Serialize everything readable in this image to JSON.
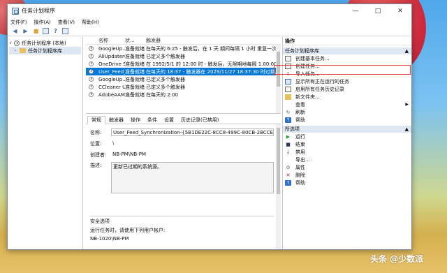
{
  "window": {
    "title": "任务计划程序"
  },
  "menu": [
    "文件(F)",
    "操作(A)",
    "查看(V)",
    "帮助(H)"
  ],
  "tree": {
    "root": "任务计划程序 (本地)",
    "child": "任务计划程序库"
  },
  "columns": [
    "名称",
    "状...",
    "触发器"
  ],
  "tasks": [
    {
      "name": "GoogleUp...",
      "status": "准备就绪",
      "trigger": "在每天的 6:25 - 触发后，在 1 天 期间每隔 1 小时 重复一次。"
    },
    {
      "name": "AliUpdater(...",
      "status": "准备就绪",
      "trigger": "已定义多个触发器"
    },
    {
      "name": "OneDrive S...",
      "status": "准备就绪",
      "trigger": "在 1992/5/1 的 12:00 时 - 触发后，无限期地每隔 1.00:00:00"
    },
    {
      "name": "User_Feed_...",
      "status": "准备就绪",
      "trigger": "在每天的 18:37 - 触发器在 2029/11/27 18:37:30 时过期。"
    },
    {
      "name": "GoogleUp...",
      "status": "准备就绪",
      "trigger": "已定义多个触发器"
    },
    {
      "name": "CCleaner U...",
      "status": "准备就绪",
      "trigger": "已定义多个触发器"
    },
    {
      "name": "AdobeAAM...",
      "status": "准备就绪",
      "trigger": "在每天的 2:00"
    }
  ],
  "tabs": [
    "常规",
    "触发器",
    "操作",
    "条件",
    "设置",
    "历史记录(已禁用)"
  ],
  "detail": {
    "name_label": "名称:",
    "name_value": "User_Feed_Synchronization-{5B1DE22C-8CC8-499C-80CB-2BCCE0CC8E20}",
    "location_label": "位置:",
    "location_value": "\\",
    "author_label": "创建者:",
    "author_value": "NB-PM\\NB-PM",
    "desc_label": "描述:",
    "desc_value": "更新已过期的系统源。",
    "security_label": "安全选项",
    "run_as_label": "运行任务时，请使用下列用户帐户:",
    "run_as_value": "NB-1020\\NB-PM"
  },
  "actions": {
    "header": "操作",
    "section1": "任务计划程序库",
    "items1": [
      {
        "label": "创建基本任务...",
        "icon": "task-basic-icon"
      },
      {
        "label": "创建任务...",
        "icon": "task-create-icon"
      },
      {
        "label": "导入任务...",
        "icon": "import-icon"
      },
      {
        "label": "显示所有正在运行的任务",
        "icon": "running-tasks-icon"
      },
      {
        "label": "启用所有任务历史记录",
        "icon": "history-icon"
      },
      {
        "label": "新文件夹...",
        "icon": "new-folder-icon"
      },
      {
        "label": "查看",
        "icon": "view-icon"
      },
      {
        "label": "刷新",
        "icon": "refresh-icon"
      },
      {
        "label": "帮助",
        "icon": "help-icon"
      }
    ],
    "section2": "所选项",
    "items2": [
      {
        "label": "运行",
        "icon": "run-icon"
      },
      {
        "label": "结束",
        "icon": "stop-icon"
      },
      {
        "label": "禁用",
        "icon": "disable-icon"
      },
      {
        "label": "导出...",
        "icon": "export-icon"
      },
      {
        "label": "属性",
        "icon": "properties-icon"
      },
      {
        "label": "删除",
        "icon": "delete-icon"
      },
      {
        "label": "帮助",
        "icon": "help-icon"
      }
    ]
  },
  "watermark": "头条 @少数派"
}
